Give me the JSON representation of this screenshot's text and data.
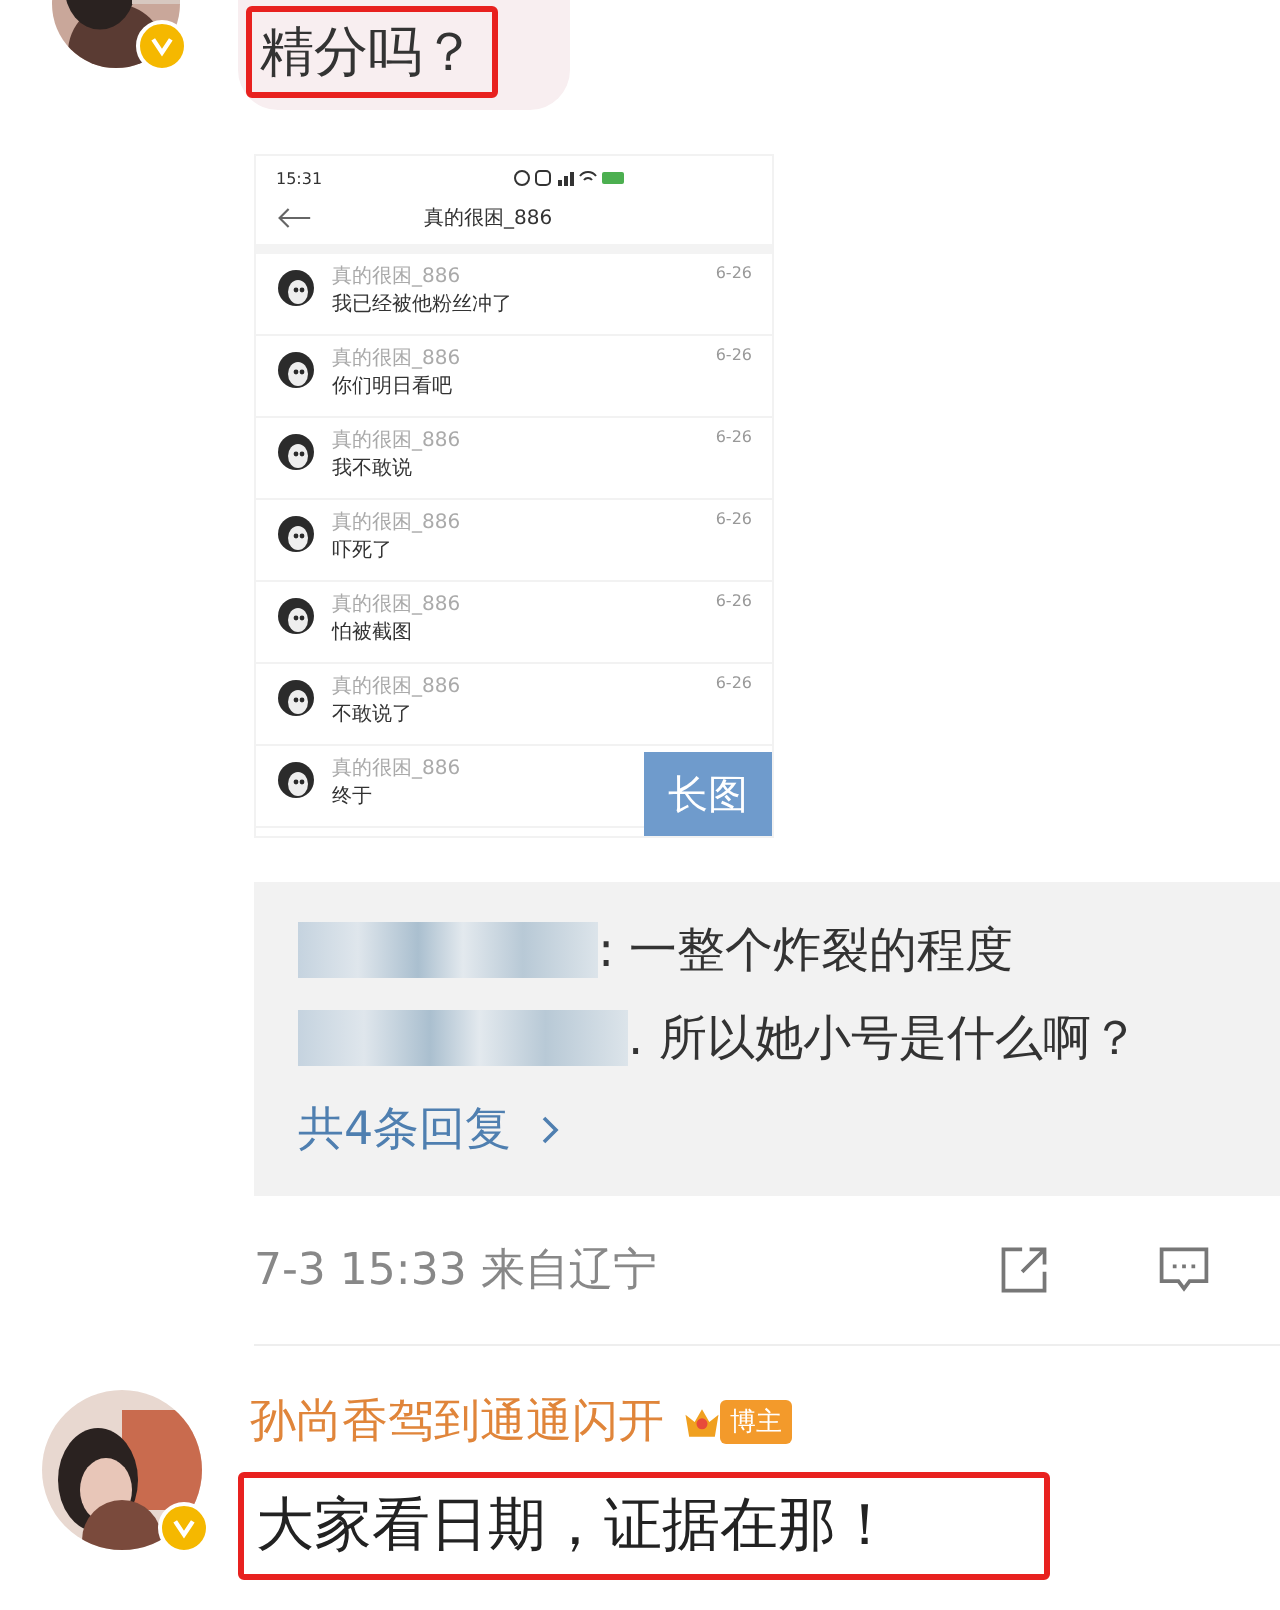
{
  "comments": [
    {
      "verified": true,
      "text": "精分吗？",
      "highlighted": true,
      "image": {
        "status_time": "15:31",
        "title": "真的很困_886",
        "badge": "长图",
        "messages": [
          {
            "sender": "真的很困_886",
            "text": "我已经被他粉丝冲了",
            "date": "6-26"
          },
          {
            "sender": "真的很困_886",
            "text": "你们明日看吧",
            "date": "6-26"
          },
          {
            "sender": "真的很困_886",
            "text": "我不敢说",
            "date": "6-26"
          },
          {
            "sender": "真的很困_886",
            "text": "吓死了",
            "date": "6-26"
          },
          {
            "sender": "真的很困_886",
            "text": "怕被截图",
            "date": "6-26"
          },
          {
            "sender": "真的很困_886",
            "text": "不敢说了",
            "date": "6-26"
          },
          {
            "sender": "真的很困_886",
            "text": "终于"
          }
        ]
      },
      "replies": [
        {
          "text": ": 一整个炸裂的程度"
        },
        {
          "text": ". 所以她小号是什么啊？"
        }
      ],
      "more": "共4条回复",
      "meta": "7-3 15:33 来自辽宁"
    },
    {
      "verified": true,
      "name": "孙尚香驾到通通闪开",
      "badge": "博主",
      "text": "大家看日期，证据在那！",
      "highlighted": true
    }
  ]
}
